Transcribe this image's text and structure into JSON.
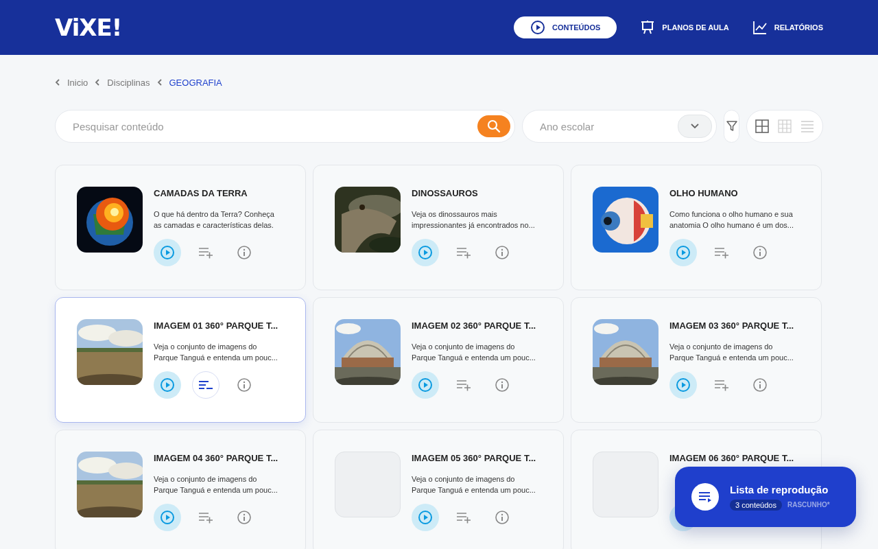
{
  "header": {
    "logo": "ViXE!",
    "nav": [
      {
        "label": "CONTEÚDOS",
        "selected": true
      },
      {
        "label": "PLANOS DE AULA",
        "selected": false
      },
      {
        "label": "RELATÓRIOS",
        "selected": false
      }
    ]
  },
  "breadcrumb": [
    {
      "label": "Inicio",
      "current": false
    },
    {
      "label": "Disciplinas",
      "current": false
    },
    {
      "label": "GEOGRAFIA",
      "current": true
    }
  ],
  "search": {
    "placeholder": "Pesquisar conteúdo"
  },
  "grade_select": {
    "placeholder": "Ano escolar"
  },
  "views": [
    {
      "kind": "large",
      "selected": true
    },
    {
      "kind": "small",
      "selected": false
    },
    {
      "kind": "list",
      "selected": false
    }
  ],
  "cards": [
    {
      "title": "CAMADAS DA TERRA",
      "description": [
        "O que há dentro da Terra? Conheça",
        "as camadas e características delas."
      ],
      "kind": "picture",
      "selected": false,
      "in_playlist": false
    },
    {
      "title": "DINOSSAUROS",
      "description": [
        "Veja os dinossauros mais",
        "impressionantes já encontrados no..."
      ],
      "kind": "picture",
      "selected": false,
      "in_playlist": false
    },
    {
      "title": "OLHO HUMANO",
      "description": [
        "Como funciona o olho humano e sua",
        "anatomia O olho humano é um dos..."
      ],
      "kind": "picture",
      "selected": false,
      "in_playlist": false
    },
    {
      "title": "IMAGEM 01 360° PARQUE T...",
      "description": [
        "Veja o conjunto de imagens do",
        "Parque Tanguá e entenda um pouc..."
      ],
      "kind": "picture",
      "selected": true,
      "in_playlist": true
    },
    {
      "title": "IMAGEM 02 360° PARQUE T...",
      "description": [
        "Veja o conjunto de imagens do",
        "Parque Tanguá e entenda um pouc..."
      ],
      "kind": "picture",
      "selected": false,
      "in_playlist": false
    },
    {
      "title": "IMAGEM 03 360° PARQUE T...",
      "description": [
        "Veja o conjunto de imagens do",
        "Parque Tanguá e entenda um pouc..."
      ],
      "kind": "picture",
      "selected": false,
      "in_playlist": false
    },
    {
      "title": "IMAGEM 04 360° PARQUE T...",
      "description": [
        "Veja o conjunto de imagens do",
        "Parque Tanguá e entenda um pouc..."
      ],
      "kind": "picture",
      "selected": false,
      "in_playlist": false
    },
    {
      "title": "IMAGEM 05 360° PARQUE T...",
      "description": [
        "Veja o conjunto de imagens do",
        "Parque Tanguá e entenda um pouc..."
      ],
      "kind": "placeholder",
      "selected": false,
      "in_playlist": false
    },
    {
      "title": "IMAGEM 06 360° PARQUE T...",
      "kind": "placeholder",
      "selected": false
    }
  ],
  "playlist": {
    "title": "Lista de reprodução",
    "count": "3 conteúdos",
    "status": "RASCUNHO*"
  }
}
